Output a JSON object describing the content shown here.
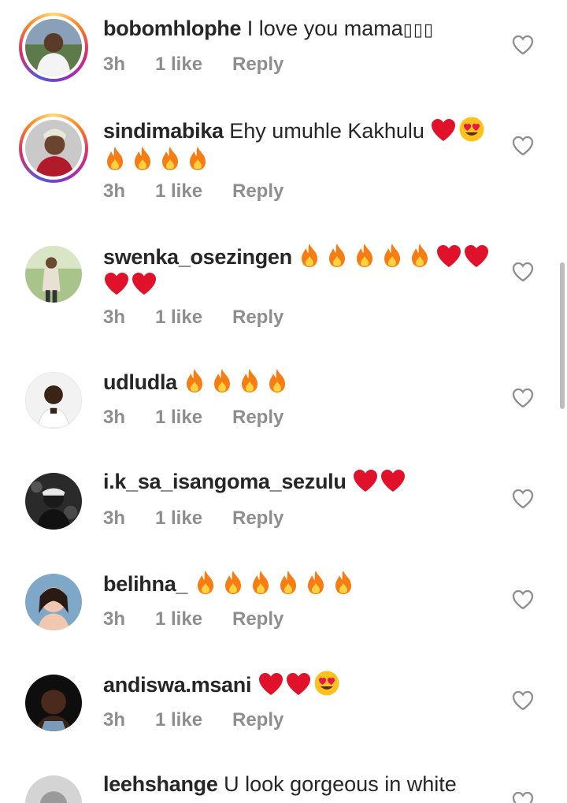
{
  "comments": [
    {
      "username": "bobomhlophe",
      "text": "I love you mama",
      "suffix": "",
      "time": "3h",
      "likes": "1 like",
      "reply": "Reply",
      "story_ring": true
    },
    {
      "username": "sindimabika",
      "text": "Ehy umuhle Kakhulu",
      "time": "3h",
      "likes": "1 like",
      "reply": "Reply",
      "story_ring": true
    },
    {
      "username": "swenka_osezingen",
      "text": "",
      "time": "3h",
      "likes": "1 like",
      "reply": "Reply",
      "story_ring": false
    },
    {
      "username": "udludla",
      "text": "",
      "time": "3h",
      "likes": "1 like",
      "reply": "Reply",
      "story_ring": false
    },
    {
      "username": "i.k_sa_isangoma_sezulu",
      "text": "",
      "time": "3h",
      "likes": "1 like",
      "reply": "Reply",
      "story_ring": false
    },
    {
      "username": "belihna_",
      "text": "",
      "time": "3h",
      "likes": "1 like",
      "reply": "Reply",
      "story_ring": false
    },
    {
      "username": "andiswa.msani",
      "text": "",
      "time": "3h",
      "likes": "1 like",
      "reply": "Reply",
      "story_ring": false
    },
    {
      "username": "leehshange",
      "text": "U look gorgeous in white",
      "time": "",
      "likes": "",
      "reply": "",
      "story_ring": false
    }
  ],
  "icons": {
    "like": "heart-outline-icon",
    "fire": "fire-emoji",
    "heart": "red-heart-emoji",
    "heart_eyes": "heart-eyes-emoji"
  },
  "colors": {
    "text": "#262626",
    "meta": "#8e8e8e",
    "heart": "#e0112b",
    "scrollbar": "#bdbdbd"
  }
}
